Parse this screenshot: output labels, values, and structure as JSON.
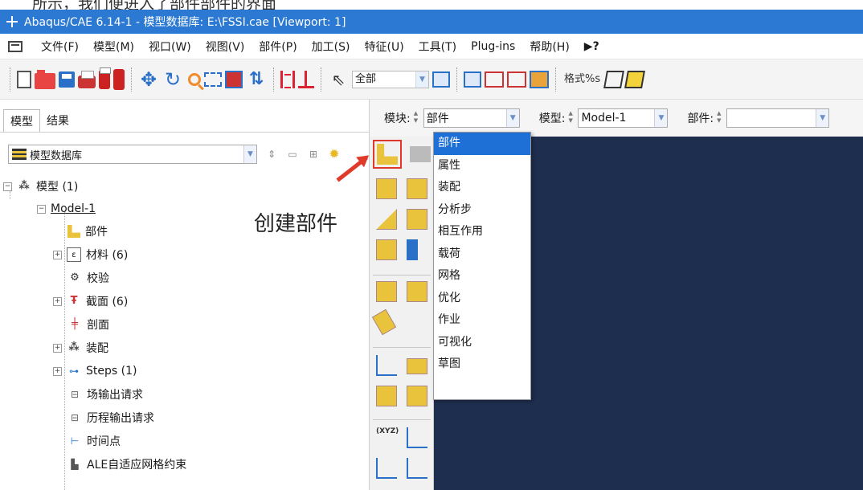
{
  "top_crop_text": "所示，我们便进入了部件部件的界面",
  "window": {
    "title": "Abaqus/CAE 6.14-1 - 模型数据库: E:\\FSSI.cae [Viewport: 1]"
  },
  "menu": {
    "items": [
      {
        "label": "文件(F)"
      },
      {
        "label": "模型(M)"
      },
      {
        "label": "视口(W)"
      },
      {
        "label": "视图(V)"
      },
      {
        "label": "部件(P)"
      },
      {
        "label": "加工(S)"
      },
      {
        "label": "特征(U)"
      },
      {
        "label": "工具(T)"
      },
      {
        "label": "Plug-ins"
      },
      {
        "label": "帮助(H)"
      },
      {
        "label": "▶?"
      }
    ]
  },
  "toolbar": {
    "select_value": "全部",
    "format_text": "格式%s"
  },
  "left_panel": {
    "tabs": [
      {
        "label": "模型",
        "active": true
      },
      {
        "label": "结果",
        "active": false
      }
    ],
    "db_select": "模型数据库",
    "tree": {
      "root": "模型 (1)",
      "model": "Model-1",
      "items": [
        {
          "label": "部件",
          "icon": "part-icon",
          "expandable": false
        },
        {
          "label": "材料 (6)",
          "icon": "material-icon",
          "expandable": true
        },
        {
          "label": "校验",
          "icon": "calibration-icon",
          "expandable": false
        },
        {
          "label": "截面 (6)",
          "icon": "section-icon",
          "expandable": true
        },
        {
          "label": "剖面",
          "icon": "profile-icon",
          "expandable": false
        },
        {
          "label": "装配",
          "icon": "assembly-icon",
          "expandable": true
        },
        {
          "label": "Steps (1)",
          "icon": "steps-icon",
          "expandable": true
        },
        {
          "label": "场输出请求",
          "icon": "field-output-icon",
          "expandable": false
        },
        {
          "label": "历程输出请求",
          "icon": "history-output-icon",
          "expandable": false
        },
        {
          "label": "时间点",
          "icon": "time-points-icon",
          "expandable": false
        },
        {
          "label": "ALE自适应网格约束",
          "icon": "ale-icon",
          "expandable": false
        }
      ]
    }
  },
  "annotation": {
    "text": "创建部件",
    "arrow_color": "#e03a2a"
  },
  "context_bar": {
    "module_label": "模块:",
    "module_value": "部件",
    "model_label": "模型:",
    "model_value": "Model-1",
    "part_label": "部件:",
    "part_value": ""
  },
  "module_dropdown": {
    "options": [
      "部件",
      "属性",
      "装配",
      "分析步",
      "相互作用",
      "载荷",
      "网格",
      "优化",
      "作业",
      "可视化",
      "草图"
    ],
    "selected": "部件"
  },
  "colors": {
    "titlebar": "#2b79d2",
    "viewport_bg": "#1e2e4f",
    "selection": "#1e6fd6",
    "highlight_red": "#e0382a"
  }
}
